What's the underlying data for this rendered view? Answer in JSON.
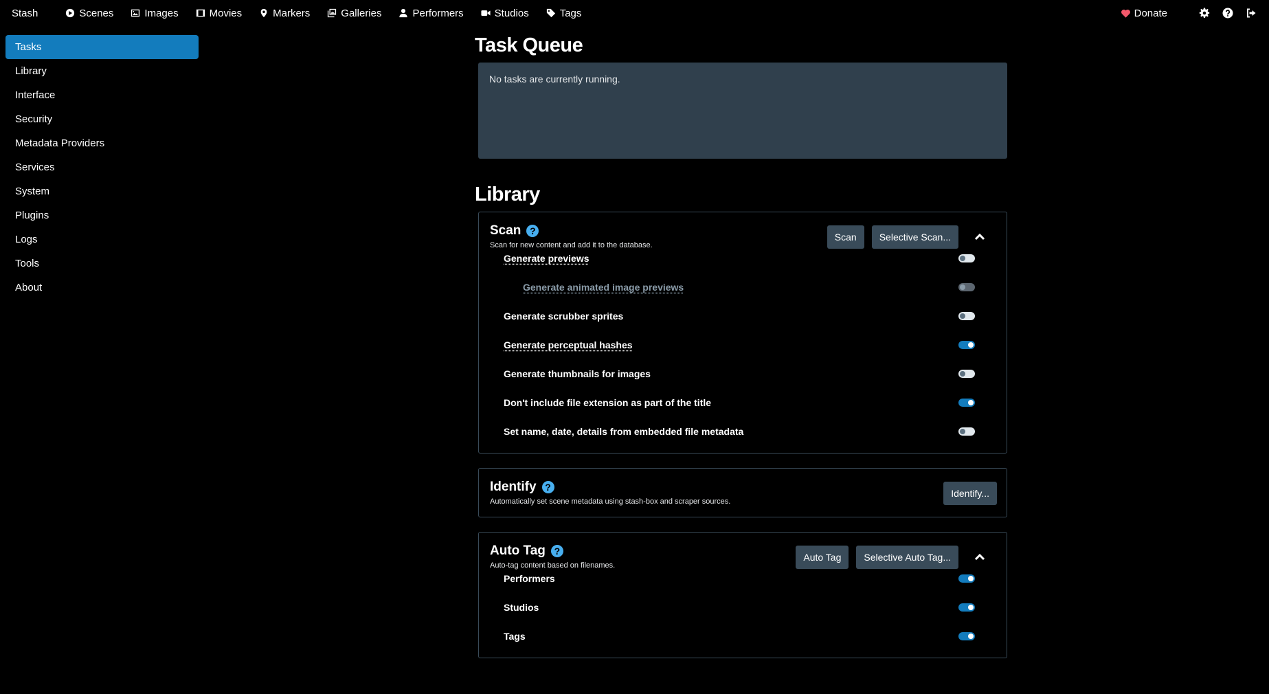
{
  "nav": {
    "brand": "Stash",
    "items": [
      {
        "label": "Scenes",
        "icon": "play-circle-icon"
      },
      {
        "label": "Images",
        "icon": "image-icon"
      },
      {
        "label": "Movies",
        "icon": "film-icon"
      },
      {
        "label": "Markers",
        "icon": "map-marker-icon"
      },
      {
        "label": "Galleries",
        "icon": "images-icon"
      },
      {
        "label": "Performers",
        "icon": "user-icon"
      },
      {
        "label": "Studios",
        "icon": "video-camera-icon"
      },
      {
        "label": "Tags",
        "icon": "tag-icon"
      }
    ],
    "donate": "Donate"
  },
  "sidebar": {
    "items": [
      {
        "label": "Tasks"
      },
      {
        "label": "Library"
      },
      {
        "label": "Interface"
      },
      {
        "label": "Security"
      },
      {
        "label": "Metadata Providers"
      },
      {
        "label": "Services"
      },
      {
        "label": "System"
      },
      {
        "label": "Plugins"
      },
      {
        "label": "Logs"
      },
      {
        "label": "Tools"
      },
      {
        "label": "About"
      }
    ],
    "active": "Tasks"
  },
  "task_queue": {
    "title": "Task Queue",
    "message": "No tasks are currently running."
  },
  "library": {
    "title": "Library",
    "scan": {
      "title": "Scan",
      "subtitle": "Scan for new content and add it to the database.",
      "scan_button": "Scan",
      "selective_button": "Selective Scan...",
      "options": [
        {
          "label": "Generate previews",
          "on": false
        },
        {
          "label": "Generate animated image previews",
          "on": false,
          "disabled": true
        },
        {
          "label": "Generate scrubber sprites",
          "on": false
        },
        {
          "label": "Generate perceptual hashes",
          "on": true
        },
        {
          "label": "Generate thumbnails for images",
          "on": false
        },
        {
          "label": "Don't include file extension as part of the title",
          "on": true
        },
        {
          "label": "Set name, date, details from embedded file metadata",
          "on": false
        }
      ]
    },
    "identify": {
      "title": "Identify",
      "subtitle": "Automatically set scene metadata using stash-box and scraper sources.",
      "button": "Identify..."
    },
    "auto_tag": {
      "title": "Auto Tag",
      "subtitle": "Auto-tag content based on filenames.",
      "button": "Auto Tag",
      "selective_button": "Selective Auto Tag...",
      "options": [
        {
          "label": "Performers",
          "on": true
        },
        {
          "label": "Studios",
          "on": true
        },
        {
          "label": "Tags",
          "on": true
        }
      ]
    }
  },
  "colors": {
    "accent": "#137cbd",
    "help": "#48aff0",
    "panel": "#30404d",
    "button": "#394b59",
    "heart": "#f3586b"
  }
}
